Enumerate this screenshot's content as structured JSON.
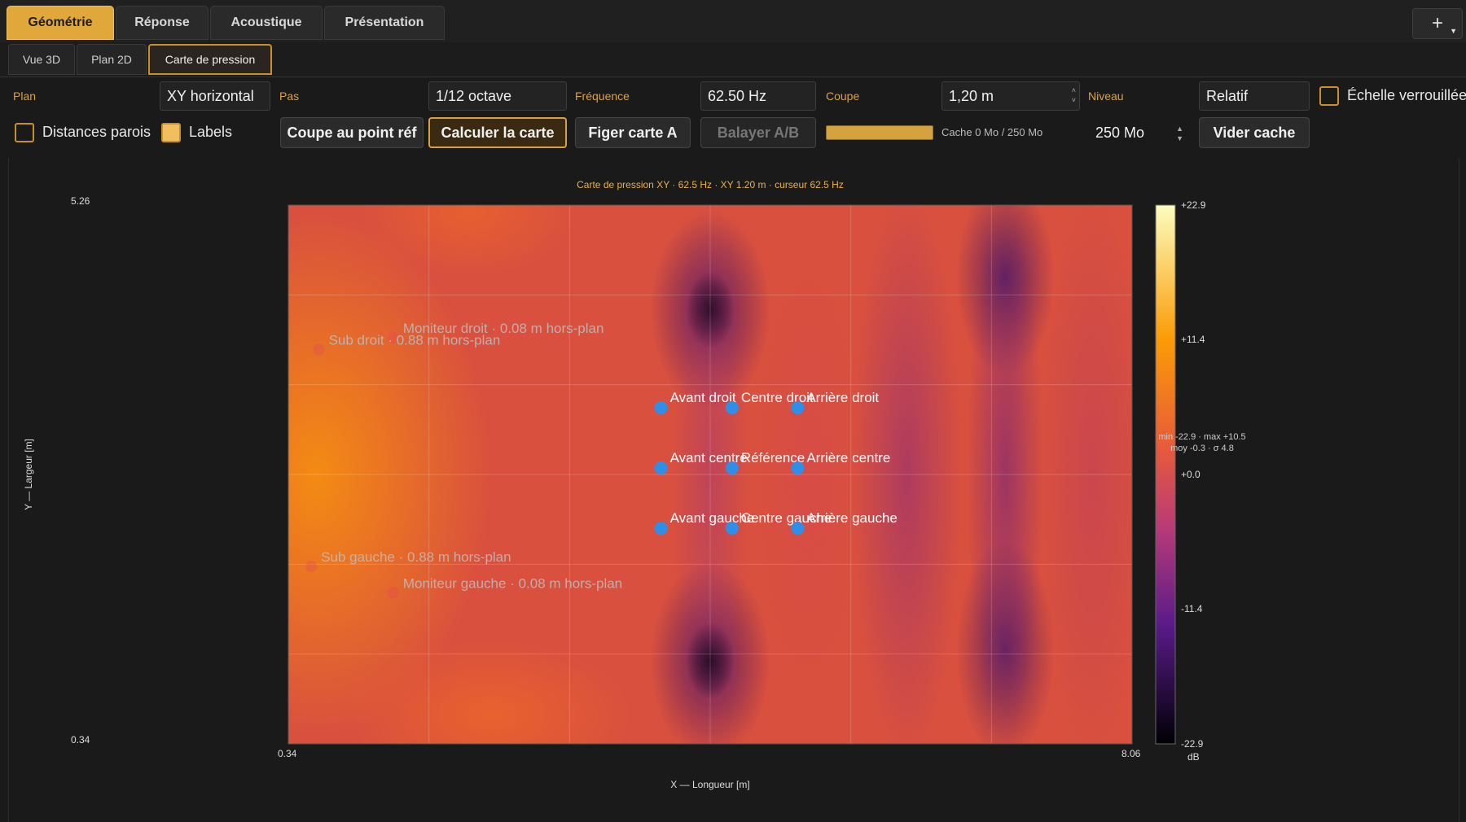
{
  "tabs": [
    {
      "label": "Géométrie",
      "active": true
    },
    {
      "label": "Réponse",
      "active": false
    },
    {
      "label": "Acoustique",
      "active": false
    },
    {
      "label": "Présentation",
      "active": false
    }
  ],
  "plus_label": "+",
  "subtabs": [
    {
      "label": "Vue 3D",
      "active": false
    },
    {
      "label": "Plan 2D",
      "active": false
    },
    {
      "label": "Carte de pression",
      "active": true
    }
  ],
  "controls": {
    "plan_label": "Plan",
    "plan_value": "XY horizontal",
    "pas_label": "Pas",
    "pas_value": "1/12 octave",
    "freq_label": "Fréquence",
    "freq_value": "62.50 Hz",
    "coupe_label": "Coupe",
    "coupe_value": "1,20 m",
    "niveau_label": "Niveau",
    "niveau_value": "Relatif",
    "echelle_label": "Échelle verrouillée",
    "echelle_checked": false,
    "distances_label": "Distances parois",
    "distances_checked": false,
    "labels_label": "Labels",
    "labels_checked": true,
    "btn_coupe": "Coupe au point réf",
    "btn_calculer": "Calculer la carte",
    "btn_figer": "Figer carte A",
    "btn_balayer": "Balayer A/B",
    "cache_text": "Cache 0 Mo / 250 Mo",
    "cache_progress": 1.0,
    "cache_size": "250 Mo",
    "btn_vider": "Vider cache"
  },
  "colors": {
    "accent": "#e0a83a",
    "marker": "#2f8fe8",
    "bg": "#1a1a1a"
  },
  "chart_data": {
    "type": "heatmap",
    "title": "Carte de pression XY · 62.5 Hz · XY 1.20 m · curseur 62.5 Hz",
    "xlabel": "X — Longueur [m]",
    "ylabel": "Y — Largeur [m]",
    "xlim": [
      0.34,
      8.06
    ],
    "ylim": [
      0.34,
      5.26
    ],
    "x_ticks": [
      "0.34",
      "8.06"
    ],
    "y_ticks": [
      "5.26",
      "0.34"
    ],
    "colorbar": {
      "ticks": [
        "+22.9",
        "+11.4",
        "+0.0",
        "-11.4",
        "-22.9"
      ],
      "tick_values": [
        22.9,
        11.4,
        0.0,
        -11.4,
        -22.9
      ],
      "unit": "dB",
      "range": [
        -22.9,
        22.9
      ],
      "stats_line1": "min -22.9 · max +10.5",
      "stats_line2": "moy -0.3 · σ 4.8"
    },
    "grid": true,
    "listeners": [
      {
        "label": "Avant droit",
        "x": 3.75,
        "y": 3.41
      },
      {
        "label": "Centre droit",
        "x": 4.4,
        "y": 3.41
      },
      {
        "label": "Arrière droit",
        "x": 5.0,
        "y": 3.41
      },
      {
        "label": "Avant centre",
        "x": 3.75,
        "y": 2.86
      },
      {
        "label": "Référence",
        "x": 4.4,
        "y": 2.86
      },
      {
        "label": "Arrière centre",
        "x": 5.0,
        "y": 2.86
      },
      {
        "label": "Avant gauche",
        "x": 3.75,
        "y": 2.31
      },
      {
        "label": "Centre gauche",
        "x": 4.4,
        "y": 2.31
      },
      {
        "label": "Arrière gauche",
        "x": 5.0,
        "y": 2.31
      }
    ],
    "sources": [
      {
        "label": "Moniteur droit · 0.08 m hors-plan",
        "x": 1.3,
        "y": 4.05
      },
      {
        "label": "Sub droit · 0.88 m hors-plan",
        "x": 0.62,
        "y": 3.94
      },
      {
        "label": "Sub gauche · 0.88 m hors-plan",
        "x": 0.55,
        "y": 1.96
      },
      {
        "label": "Moniteur gauche · 0.08 m hors-plan",
        "x": 1.3,
        "y": 1.72
      }
    ]
  }
}
